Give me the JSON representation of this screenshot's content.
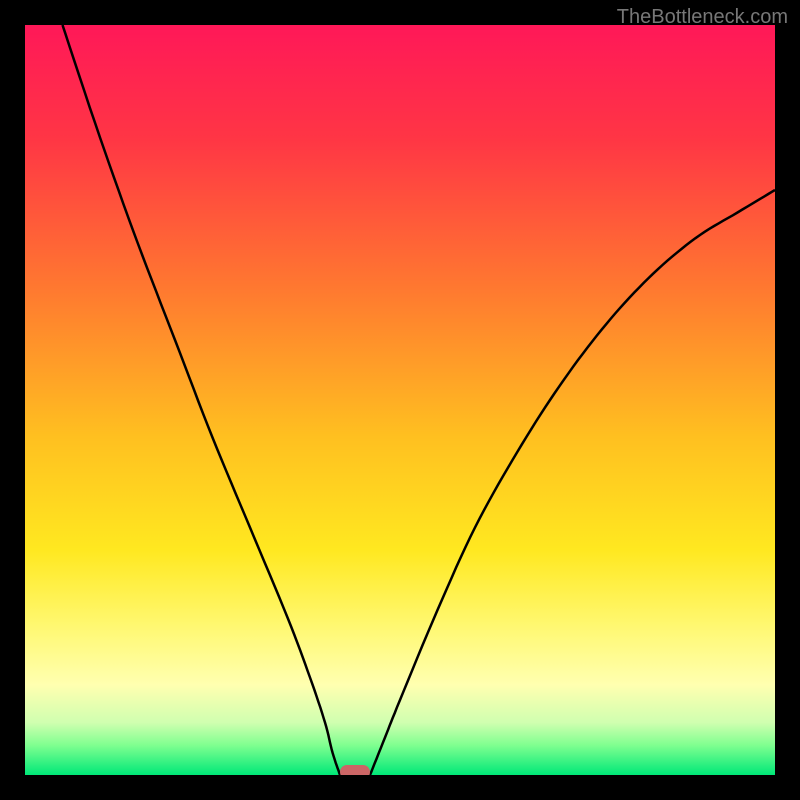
{
  "watermark": "TheBottleneck.com",
  "chart_data": {
    "type": "line",
    "title": "",
    "xlabel": "",
    "ylabel": "",
    "xlim": [
      0,
      100
    ],
    "ylim": [
      0,
      100
    ],
    "series": [
      {
        "name": "left-curve",
        "x": [
          5,
          10,
          15,
          20,
          25,
          30,
          35,
          38,
          40,
          41,
          42
        ],
        "y": [
          100,
          85,
          71,
          58,
          45,
          33,
          21,
          13,
          7,
          3,
          0
        ]
      },
      {
        "name": "right-curve",
        "x": [
          46,
          48,
          50,
          55,
          60,
          65,
          70,
          75,
          80,
          85,
          90,
          95,
          100
        ],
        "y": [
          0,
          5,
          10,
          22,
          33,
          42,
          50,
          57,
          63,
          68,
          72,
          75,
          78
        ]
      }
    ],
    "marker": {
      "x": 44,
      "y": 0,
      "width": 4,
      "color": "#cc6666"
    },
    "gradient_stops": [
      {
        "offset": 0,
        "color": "#ff1858"
      },
      {
        "offset": 15,
        "color": "#ff3545"
      },
      {
        "offset": 35,
        "color": "#ff7830"
      },
      {
        "offset": 55,
        "color": "#ffc020"
      },
      {
        "offset": 70,
        "color": "#ffe820"
      },
      {
        "offset": 80,
        "color": "#fff870"
      },
      {
        "offset": 88,
        "color": "#ffffb0"
      },
      {
        "offset": 93,
        "color": "#d0ffb0"
      },
      {
        "offset": 96,
        "color": "#80ff90"
      },
      {
        "offset": 100,
        "color": "#00e878"
      }
    ]
  }
}
